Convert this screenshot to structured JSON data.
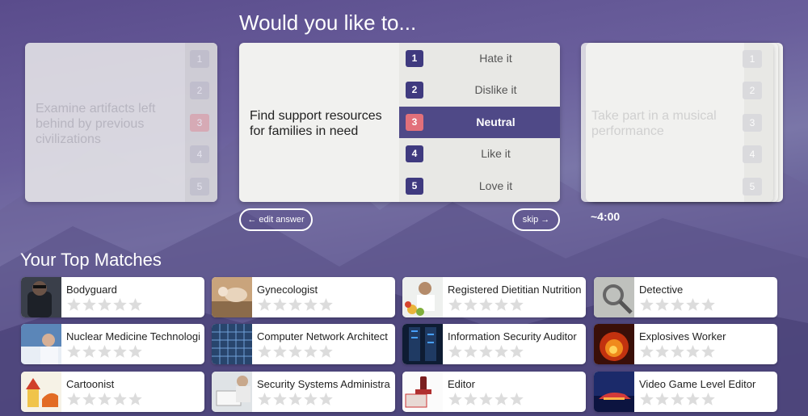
{
  "heading": "Would you like to...",
  "cards": {
    "left": {
      "question": "Examine artifacts left behind by previous civilizations",
      "numbers": [
        "1",
        "2",
        "3",
        "4",
        "5"
      ]
    },
    "center": {
      "question": "Find support resources for families in need",
      "options": [
        {
          "num": "1",
          "label": "Hate it"
        },
        {
          "num": "2",
          "label": "Dislike it"
        },
        {
          "num": "3",
          "label": "Neutral"
        },
        {
          "num": "4",
          "label": "Like it"
        },
        {
          "num": "5",
          "label": "Love it"
        }
      ],
      "selected": 3
    },
    "right": {
      "question": "Take part in a musical performance",
      "numbers": [
        "1",
        "2",
        "3",
        "4",
        "5"
      ]
    }
  },
  "edit_answer": "← edit answer",
  "skip": "skip →",
  "timer": "~4:00",
  "matches_title": "Your Top Matches",
  "matches": [
    {
      "name": "Bodyguard",
      "thumb": "bodyguard"
    },
    {
      "name": "Gynecologist",
      "thumb": "gynecologist"
    },
    {
      "name": "Registered Dietitian Nutritionist",
      "thumb": "dietitian"
    },
    {
      "name": "Detective",
      "thumb": "detective"
    },
    {
      "name": "Nuclear Medicine Technologist",
      "thumb": "nuclear"
    },
    {
      "name": "Computer Network Architect",
      "thumb": "network"
    },
    {
      "name": "Information Security Auditor",
      "thumb": "security-auditor"
    },
    {
      "name": "Explosives Worker",
      "thumb": "explosives"
    },
    {
      "name": "Cartoonist",
      "thumb": "cartoonist"
    },
    {
      "name": "Security Systems Administrator",
      "thumb": "security-admin"
    },
    {
      "name": "Editor",
      "thumb": "editor"
    },
    {
      "name": "Video Game Level Editor",
      "thumb": "game-editor"
    }
  ],
  "colors": {
    "accent": "#4f4987",
    "number_badge": "#3f3a7f",
    "neutral_badge": "#e2707a",
    "star_empty": "#dcdcdc"
  }
}
